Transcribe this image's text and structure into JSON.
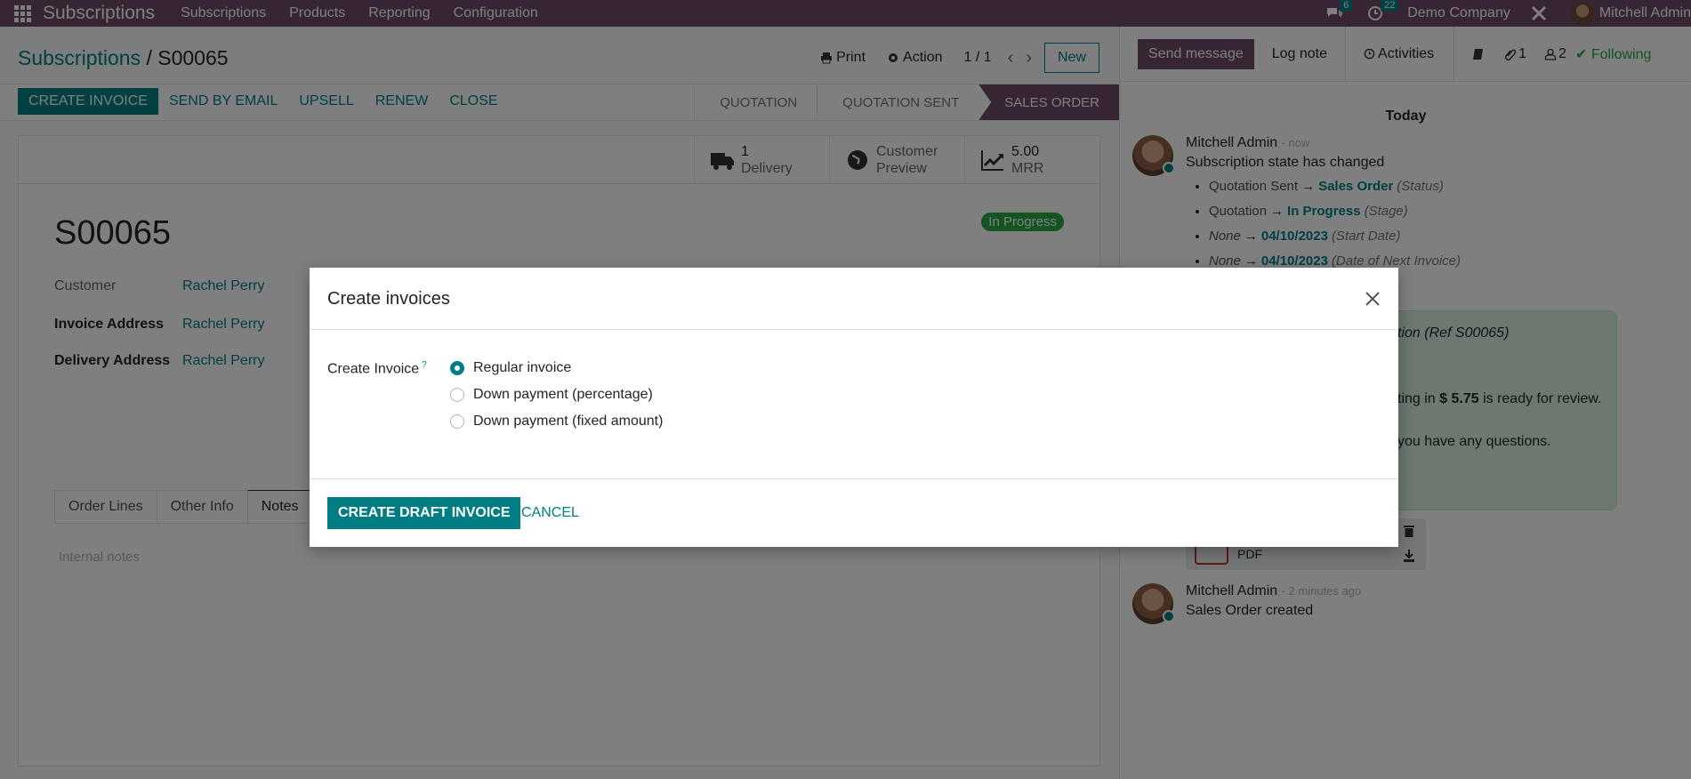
{
  "navbar": {
    "app_name": "Subscriptions",
    "menu": [
      "Subscriptions",
      "Products",
      "Reporting",
      "Configuration"
    ],
    "messages_count": "6",
    "activities_count": "22",
    "company": "Demo Company",
    "user": "Mitchell Admin"
  },
  "control_panel": {
    "breadcrumb_parent": "Subscriptions",
    "breadcrumb_separator": "/",
    "breadcrumb_current": "S00065",
    "print_label": "Print",
    "action_label": "Action",
    "pager": "1 / 1",
    "new_label": "New"
  },
  "statusbar": {
    "buttons": [
      "Create Invoice",
      "Send by Email",
      "Upsell",
      "Renew",
      "Close"
    ],
    "stages": [
      "Quotation",
      "Quotation Sent",
      "Sales Order"
    ],
    "active_stage": "Sales Order"
  },
  "sheet": {
    "smart_buttons": [
      {
        "value": "1",
        "label": "Delivery",
        "icon": "truck-icon"
      },
      {
        "value": "Customer",
        "label": "Preview",
        "icon": "globe-icon"
      },
      {
        "value": "5.00",
        "label": "MRR",
        "icon": "line-chart-icon"
      }
    ],
    "stage_badge": "In Progress",
    "record_name": "S00065",
    "fields": [
      {
        "label": "Customer",
        "value": "Rachel Perry"
      },
      {
        "label": "Invoice Address",
        "value": "Rachel Perry"
      },
      {
        "label": "Delivery Address",
        "value": "Rachel Perry"
      }
    ],
    "tabs": [
      "Order Lines",
      "Other Info",
      "Notes"
    ],
    "active_tab": "Notes",
    "notes_placeholder": "Internal notes"
  },
  "chatter": {
    "send_message": "Send message",
    "log_note": "Log note",
    "activities": "Activities",
    "attachments_count": "1",
    "followers_count": "2",
    "following": "Following",
    "date_separator": "Today",
    "messages": [
      {
        "author": "Mitchell Admin",
        "when": "- now",
        "text": "Subscription state has changed",
        "tracking": [
          {
            "old": "Quotation Sent",
            "new": "Sales Order",
            "field": "(Status)"
          },
          {
            "old": "Quotation",
            "new": "In Progress",
            "field": "(Stage)"
          },
          {
            "old": "None",
            "new": "04/10/2023",
            "field": "(Start Date)"
          },
          {
            "old": "None",
            "new": "04/10/2023",
            "field": "(Date of Next Invoice)"
          }
        ]
      },
      {
        "author": "Mitchell Admin",
        "when": "- 2 minutes ago",
        "text": "Sales Order created"
      }
    ],
    "mail_card": {
      "line1_tail": "tion (Ref S00065)",
      "line2_prefix": "ting in ",
      "line2_amount": "$ 5.75",
      "line2_suffix": " is ready for review.",
      "line3_tail": "you have any questions."
    },
    "attachment_label": "PDF"
  },
  "modal": {
    "title": "Create invoices",
    "field_label": "Create Invoice",
    "help_marker": "?",
    "options": [
      {
        "label": "Regular invoice",
        "checked": true
      },
      {
        "label": "Down payment (percentage)",
        "checked": false
      },
      {
        "label": "Down payment (fixed amount)",
        "checked": false
      }
    ],
    "primary_button": "Create Draft Invoice",
    "cancel_button": "Cancel"
  },
  "colors": {
    "brand": "#714b67",
    "accent": "#017e84",
    "success": "#28a745"
  }
}
